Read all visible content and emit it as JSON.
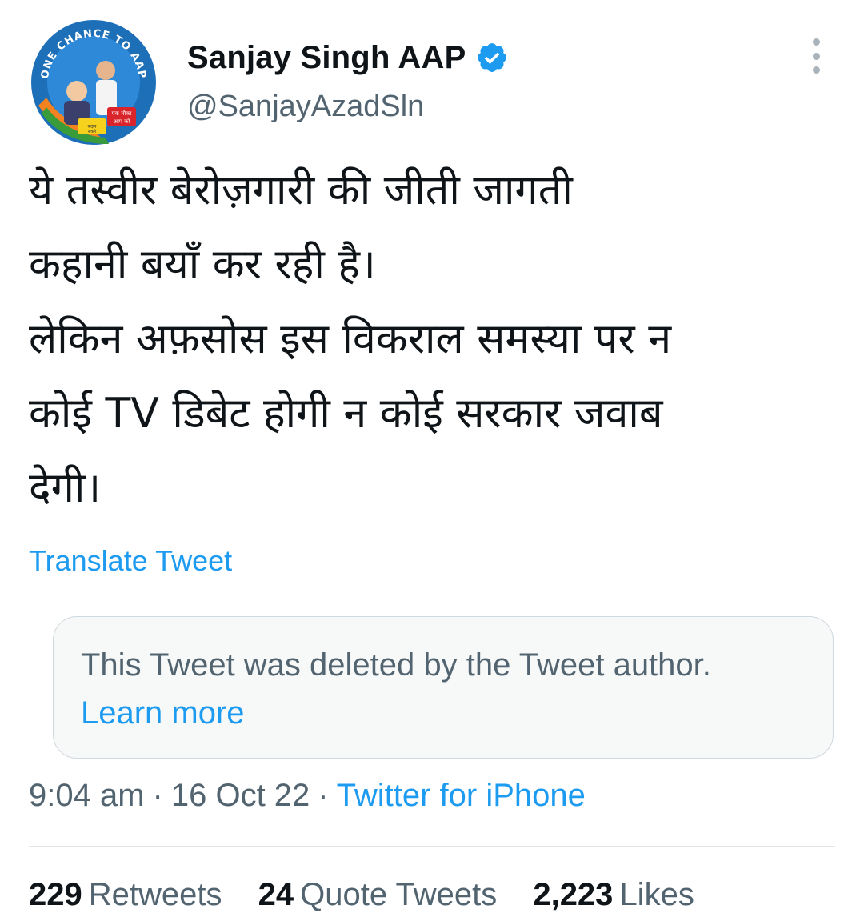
{
  "author": {
    "display_name": "Sanjay Singh AAP",
    "handle": "@SanjayAzadSln",
    "verified_icon": "verified-badge-icon",
    "avatar": {
      "arc_text": "ONE CHANCE TO AAP",
      "badge_line1": "एक मौका",
      "badge_line2": "आप को",
      "sign_text": "बदल",
      "sign_text2": "सकते"
    }
  },
  "menu": {
    "icon": "more-vertical-icon"
  },
  "tweet": {
    "lines": [
      "ये तस्वीर बेरोज़गारी की जीती जागती",
      "कहानी बयाँ कर रही है।",
      "लेकिन अफ़सोस इस विकराल समस्या पर न",
      "कोई TV डिबेट होगी न कोई सरकार जवाब",
      "देगी।"
    ],
    "translate_label": "Translate Tweet"
  },
  "quoted": {
    "deleted_text": "This Tweet was deleted by the Tweet author.",
    "learn_more": "Learn more"
  },
  "meta": {
    "time": "9:04 am",
    "separator": "·",
    "date": "16 Oct 22",
    "source": "Twitter for iPhone"
  },
  "stats": {
    "retweets_count": "229",
    "retweets_label": "Retweets",
    "quotes_count": "24",
    "quotes_label": "Quote Tweets",
    "likes_count": "2,223",
    "likes_label": "Likes"
  },
  "colors": {
    "accent": "#1d9bf0",
    "secondary_text": "#536471",
    "primary_text": "#0f1419",
    "card_bg": "#f7f9f9",
    "border": "#cfd9de"
  }
}
